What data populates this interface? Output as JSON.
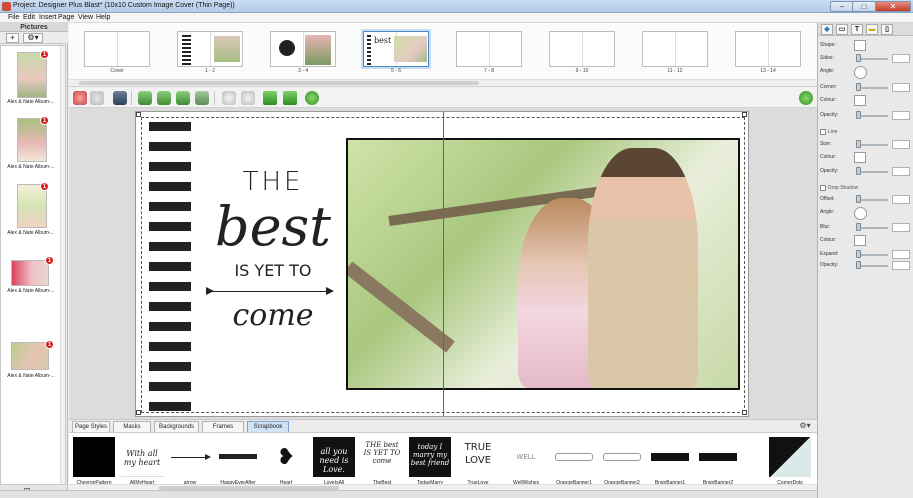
{
  "window": {
    "title": "Project: Designer Plus Blast* (10x10 Custom Image Cover (Thin Page))"
  },
  "menu": [
    "File",
    "Edit",
    "Insert",
    "Page",
    "View",
    "Help"
  ],
  "pictures_panel": {
    "header": "Pictures",
    "items": [
      {
        "caption": "Alex & Nate Album-...",
        "badge": "1"
      },
      {
        "caption": "Alex & Nate Album-...",
        "badge": "1"
      },
      {
        "caption": "Alex & Nate Album-...",
        "badge": "1"
      },
      {
        "caption": "Alex & Nate Album-...",
        "badge": "1"
      },
      {
        "caption": "Alex & Nate Album-...",
        "badge": "1"
      }
    ]
  },
  "pages": [
    "Cover",
    "1 - 2",
    "3 - 4",
    "5 - 6",
    "7 - 8",
    "9 - 10",
    "11 - 12",
    "13 - 14"
  ],
  "selected_page": "5 - 6",
  "artwork": {
    "line1": "THE",
    "line2": "best",
    "line3": "IS YET TO",
    "line4": "come"
  },
  "bottom_tabs": [
    "Page Styles",
    "Masks",
    "Backgrounds",
    "Frames",
    "Scrapbook"
  ],
  "active_tab": "Scrapbook",
  "scrapbook_items": [
    "ChevronPattern",
    "AllMyHeart",
    "arrow",
    "HappyEverAfter",
    "Heart",
    "LoveIsAll",
    "TheBest",
    "TodayMarry",
    "TrueLove",
    "WellWishes",
    "OrangeBanner1",
    "OrangeBanner2",
    "BrwnBanner1",
    "BrwnBanner2",
    "CornerDots"
  ],
  "scrapbook_previews": {
    "AllMyHeart": "With all my heart",
    "LoveIsAll": "all you need is Love.",
    "TheBest": "THE best IS YET TO come",
    "TodayMarry": "today I marry my best friend",
    "TrueLove": "TRUE LOVE",
    "WellWishes": "WELL WISHES"
  },
  "properties": {
    "fill": [
      "Shape:",
      "Sides:",
      "Angle:",
      "Corner:",
      "Colour:",
      "Opacity:"
    ],
    "line_section": "Line",
    "line": [
      "Size:",
      "Colour:",
      "Opacity:"
    ],
    "shadow_section": "Drop Shadow",
    "shadow": [
      "Offset:",
      "Angle:",
      "Blur:",
      "Colour:",
      "Expand:",
      "Opacity:"
    ]
  },
  "colors": {
    "accent": "#4a88c8",
    "stripe": "#222222",
    "badge": "#d21a1a"
  }
}
